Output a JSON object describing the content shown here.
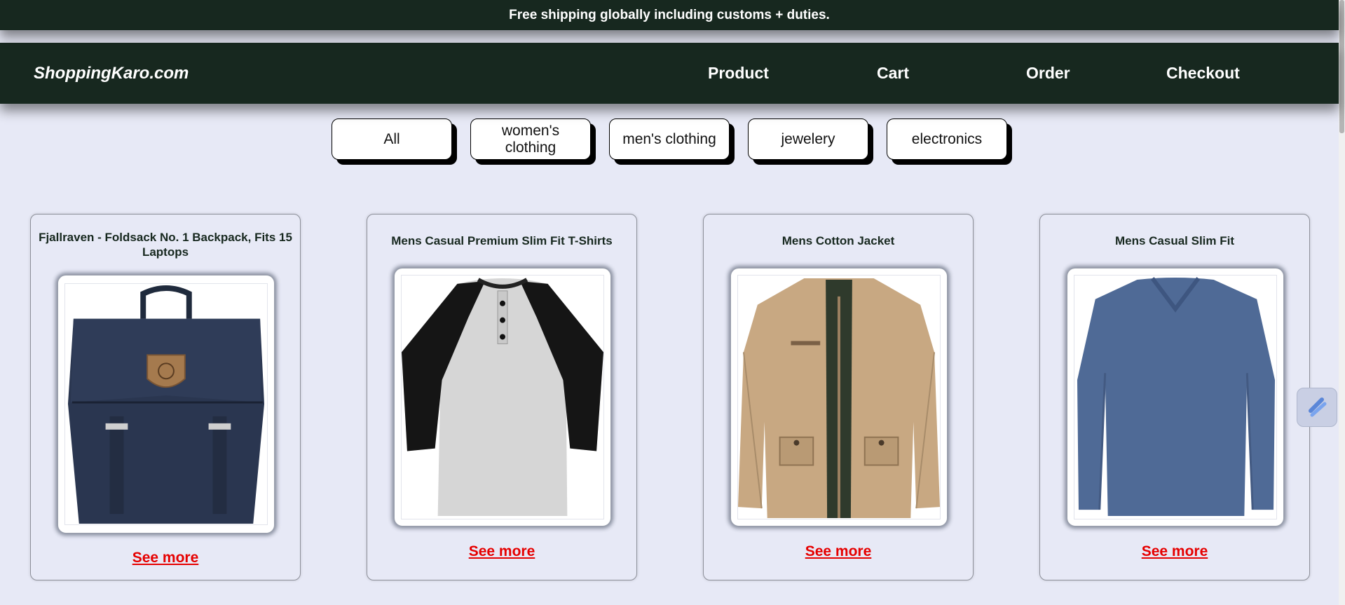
{
  "announcement": "Free shipping globally including customs + duties.",
  "header": {
    "logo": "ShoppingKaro.com",
    "nav": [
      "Product",
      "Cart",
      "Order",
      "Checkout"
    ]
  },
  "filters": [
    "All",
    "women's clothing",
    "men's clothing",
    "jewelery",
    "electronics"
  ],
  "products": [
    {
      "title": "Fjallraven - Foldsack No. 1 Backpack, Fits 15 Laptops",
      "link": "See more",
      "image": "navy-backpack"
    },
    {
      "title": "Mens Casual Premium Slim Fit T-Shirts",
      "link": "See more",
      "image": "raglan-henley-tshirt"
    },
    {
      "title": "Mens Cotton Jacket",
      "link": "See more",
      "image": "khaki-cotton-jacket"
    },
    {
      "title": "Mens Casual Slim Fit",
      "link": "See more",
      "image": "blue-longsleeve-tee"
    }
  ],
  "colors": {
    "header_bg": "#17281f",
    "page_bg": "#e7e9f6",
    "link_red": "#e60000"
  },
  "icons": [
    "swirl-icon"
  ]
}
